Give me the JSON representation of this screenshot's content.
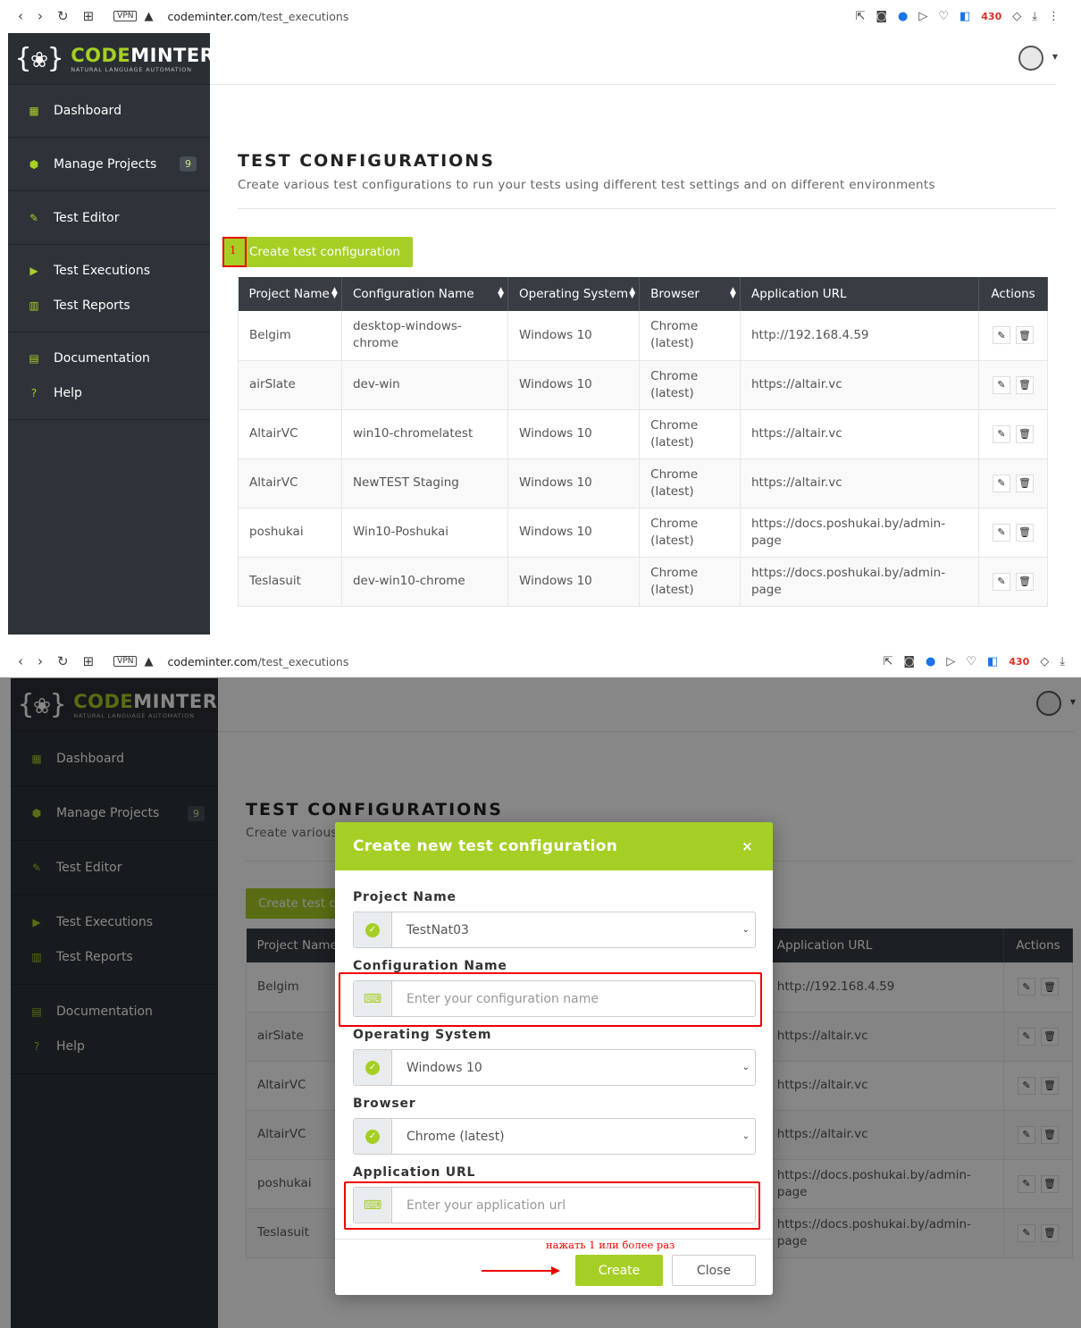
{
  "browser": {
    "url_host": "codeminter.com",
    "url_path": "/test_executions",
    "vpn_label": "VPN",
    "mail_badge": "430"
  },
  "brand": {
    "name_part1": "CODE",
    "name_part2": "MINTER",
    "tagline": "NATURAL LANGUAGE AUTOMATION",
    "accent_color": "#a6cf25",
    "sidebar_color": "#2d3338"
  },
  "sidebar": {
    "dashboard": "Dashboard",
    "manage_projects": "Manage Projects",
    "manage_projects_count": "9",
    "test_editor": "Test Editor",
    "test_executions": "Test Executions",
    "test_reports": "Test Reports",
    "documentation": "Documentation",
    "help": "Help"
  },
  "page": {
    "title": "TEST CONFIGURATIONS",
    "subtitle": "Create various test configurations to run your tests using different test settings and on different environments",
    "create_button": "Create test configuration",
    "step_marker": "1"
  },
  "table": {
    "headers": [
      "Project Name",
      "Configuration Name",
      "Operating System",
      "Browser",
      "Application URL",
      "Actions"
    ],
    "rows": [
      {
        "project": "Belgim",
        "config": "desktop-windows-chrome",
        "os": "Windows 10",
        "browser": "Chrome (latest)",
        "url": "http://192.168.4.59"
      },
      {
        "project": "airSlate",
        "config": "dev-win",
        "os": "Windows 10",
        "browser": "Chrome (latest)",
        "url": "https://altair.vc"
      },
      {
        "project": "AltairVC",
        "config": "win10-chromelatest",
        "os": "Windows 10",
        "browser": "Chrome (latest)",
        "url": "https://altair.vc"
      },
      {
        "project": "AltairVC",
        "config": "NewTEST Staging",
        "os": "Windows 10",
        "browser": "Chrome (latest)",
        "url": "https://altair.vc"
      },
      {
        "project": "poshukai",
        "config": "Win10-Poshukai",
        "os": "Windows 10",
        "browser": "Chrome (latest)",
        "url": "https://docs.poshukai.by/admin-page"
      },
      {
        "project": "Teslasuit",
        "config": "dev-win10-chrome",
        "os": "Windows 10",
        "browser": "Chrome (latest)",
        "url": "https://docs.poshukai.by/admin-page"
      }
    ]
  },
  "modal": {
    "title": "Create new test configuration",
    "close_x": "×",
    "project_label": "Project Name",
    "project_value": "TestNat03",
    "config_label": "Configuration Name",
    "config_placeholder": "Enter your configuration name",
    "os_label": "Operating System",
    "os_value": "Windows 10",
    "browser_label": "Browser",
    "browser_value": "Chrome (latest)",
    "url_label": "Application URL",
    "url_placeholder": "Enter your application url",
    "hint": "нажать 1 или более раз",
    "create_button": "Create",
    "close_button": "Close"
  }
}
